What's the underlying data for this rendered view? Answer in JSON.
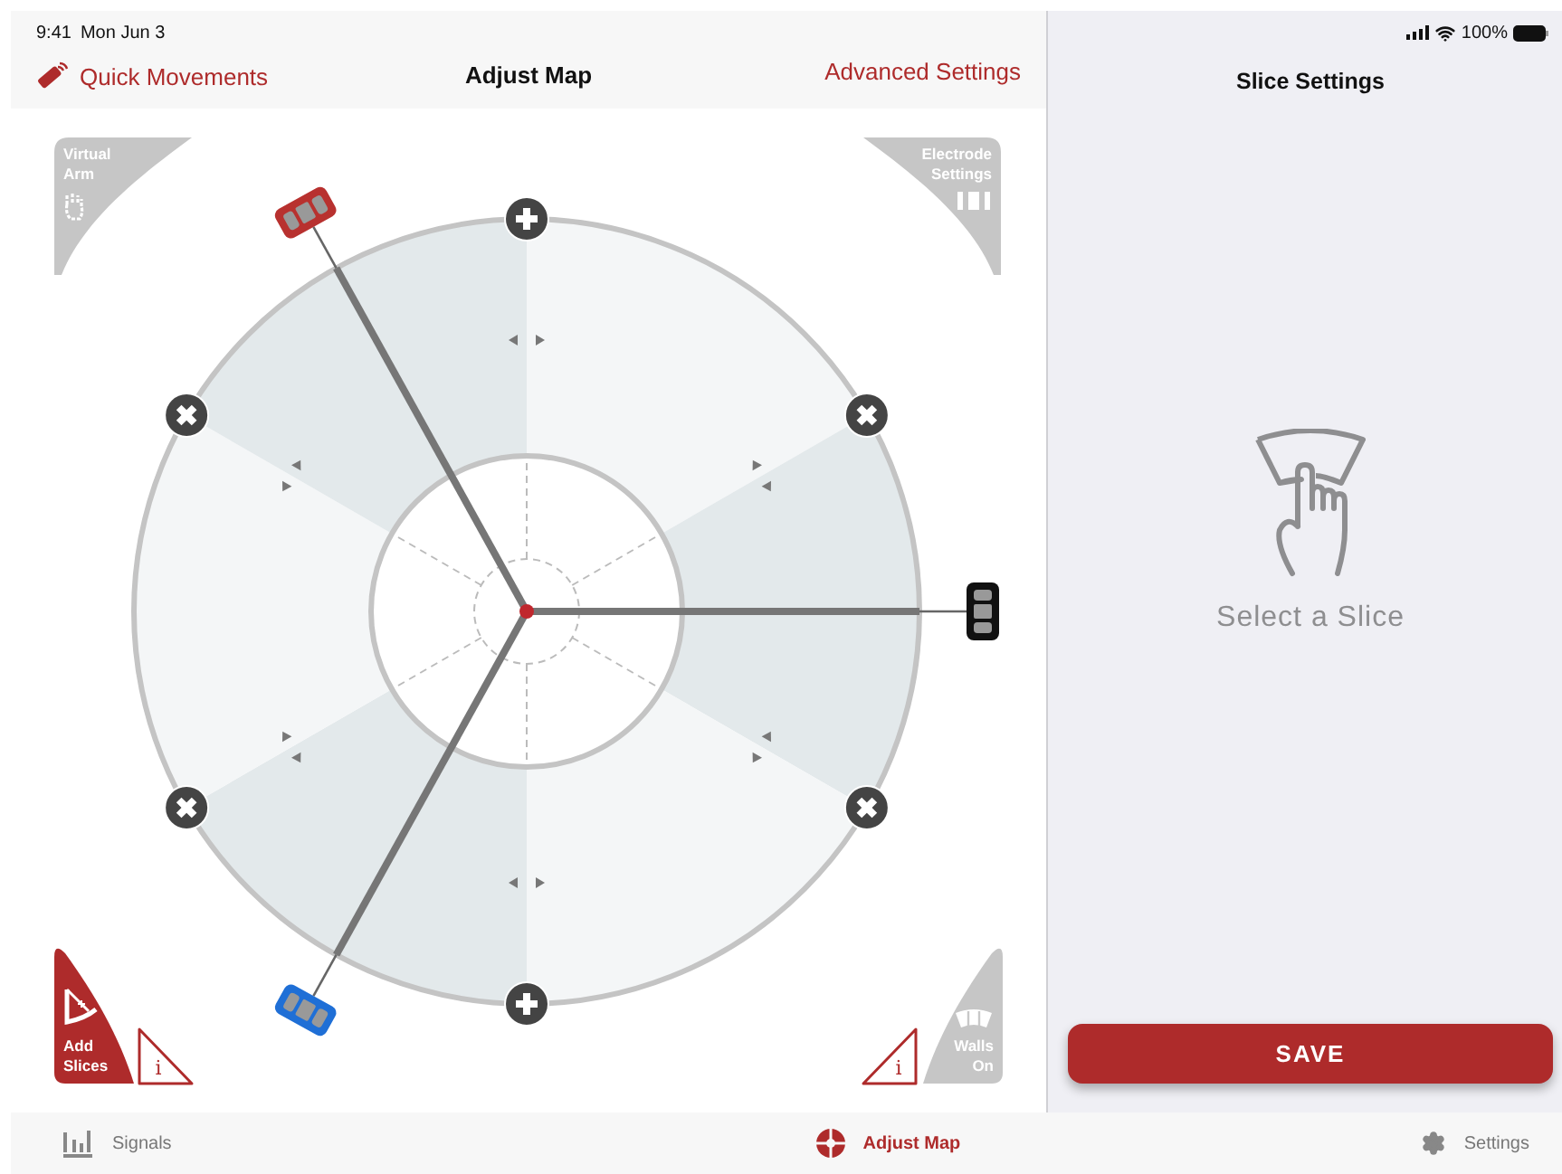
{
  "status_bar": {
    "time": "9:41",
    "date": "Mon Jun 3",
    "battery": "100%"
  },
  "nav": {
    "back": "Quick Movements",
    "title": "Adjust Map",
    "action": "Advanced Settings"
  },
  "map": {
    "corner_buttons": [
      {
        "kind": "virtual-arm",
        "label": "Virtual Arm",
        "active": false
      },
      {
        "kind": "electrode-settings",
        "label": "Electrode Settings",
        "active": false
      },
      {
        "kind": "add-slices",
        "label": "Add Slices",
        "active": true,
        "info": "i"
      },
      {
        "kind": "walls",
        "label": "Walls On",
        "active": false,
        "info": "i"
      }
    ],
    "boundary_buttons": [
      {
        "kind": "add"
      },
      {
        "kind": "remove"
      },
      {
        "kind": "remove"
      },
      {
        "kind": "add"
      },
      {
        "kind": "remove"
      },
      {
        "kind": "remove"
      }
    ],
    "electrodes": [
      {
        "color": "#b8312f"
      },
      {
        "color": "#111111"
      },
      {
        "color": "#1f6fd6"
      }
    ]
  },
  "side_panel": {
    "title": "Slice Settings",
    "empty_text": "Select a Slice",
    "save": "SAVE"
  },
  "tabs": [
    {
      "kind": "signals",
      "label": "Signals",
      "selected": false
    },
    {
      "kind": "map",
      "label": "Adjust Map",
      "selected": true
    },
    {
      "kind": "settings",
      "label": "Settings",
      "selected": false
    }
  ]
}
